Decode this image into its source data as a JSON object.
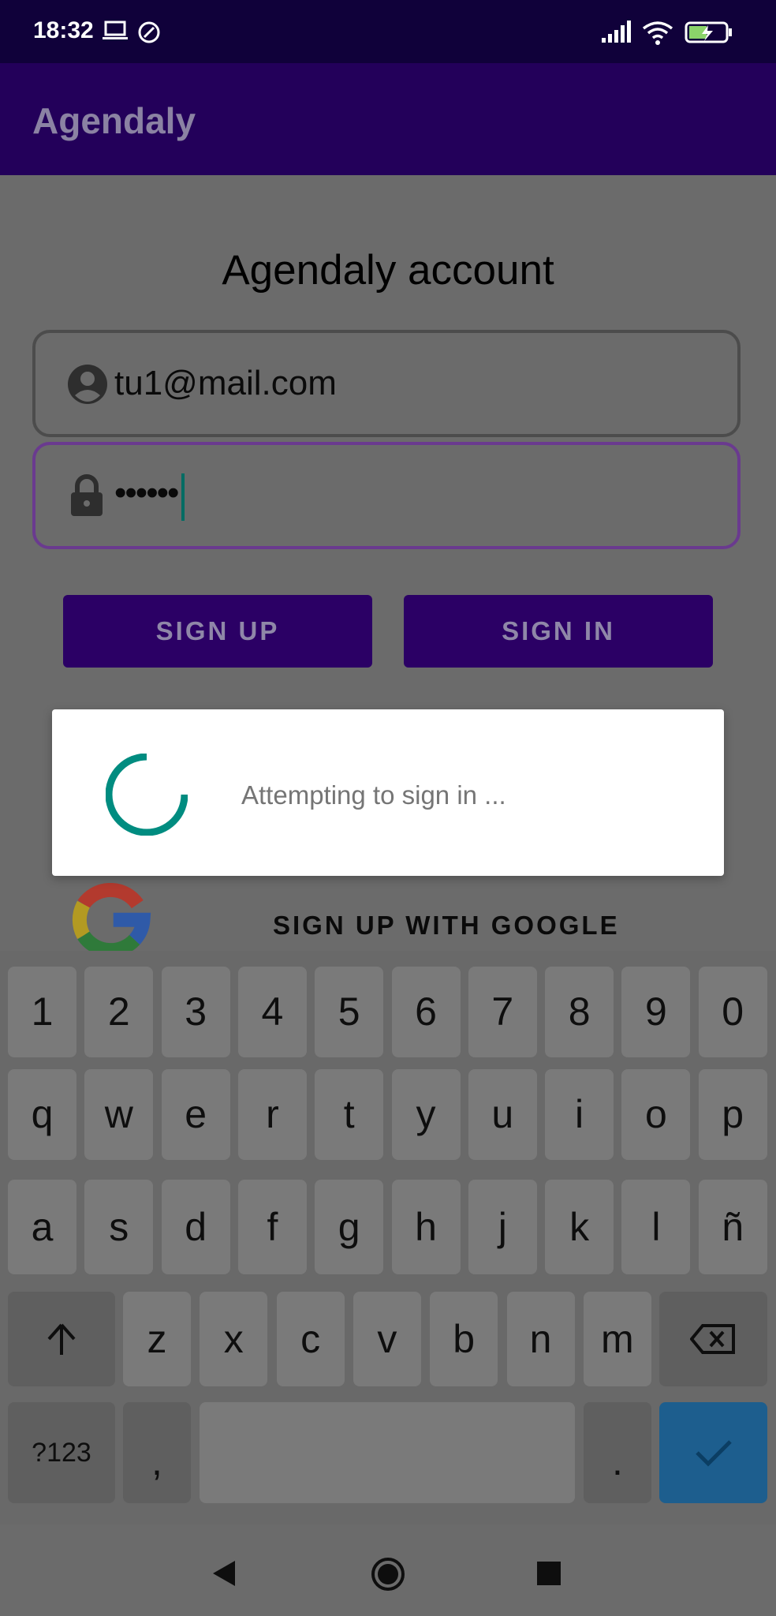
{
  "status_bar": {
    "time": "18:32",
    "icons": [
      "laptop-icon",
      "at-sign-icon",
      "signal-icon",
      "wifi-icon",
      "battery-charging-icon"
    ]
  },
  "app_bar": {
    "title": "Agendaly"
  },
  "form": {
    "heading": "Agendaly account",
    "email_value": "tu1@mail.com",
    "password_value": "••••••",
    "signup_label": "SIGN UP",
    "signin_label": "SIGN IN"
  },
  "dialog": {
    "message": "Attempting to sign in ..."
  },
  "google": {
    "label": "SIGN UP WITH GOOGLE"
  },
  "keyboard": {
    "row1": [
      "1",
      "2",
      "3",
      "4",
      "5",
      "6",
      "7",
      "8",
      "9",
      "0"
    ],
    "row2": [
      "q",
      "w",
      "e",
      "r",
      "t",
      "y",
      "u",
      "i",
      "o",
      "p"
    ],
    "row3": [
      "a",
      "s",
      "d",
      "f",
      "g",
      "h",
      "j",
      "k",
      "l",
      "ñ"
    ],
    "row4": [
      "z",
      "x",
      "c",
      "v",
      "b",
      "n",
      "m"
    ],
    "symbols_label": "?123",
    "comma_label": ",",
    "period_label": "."
  },
  "colors": {
    "status_bar": "#10013a",
    "app_bar": "#23005a",
    "button": "#2b0065",
    "spinner": "#008c80",
    "enter_key": "#1d5e8e"
  }
}
